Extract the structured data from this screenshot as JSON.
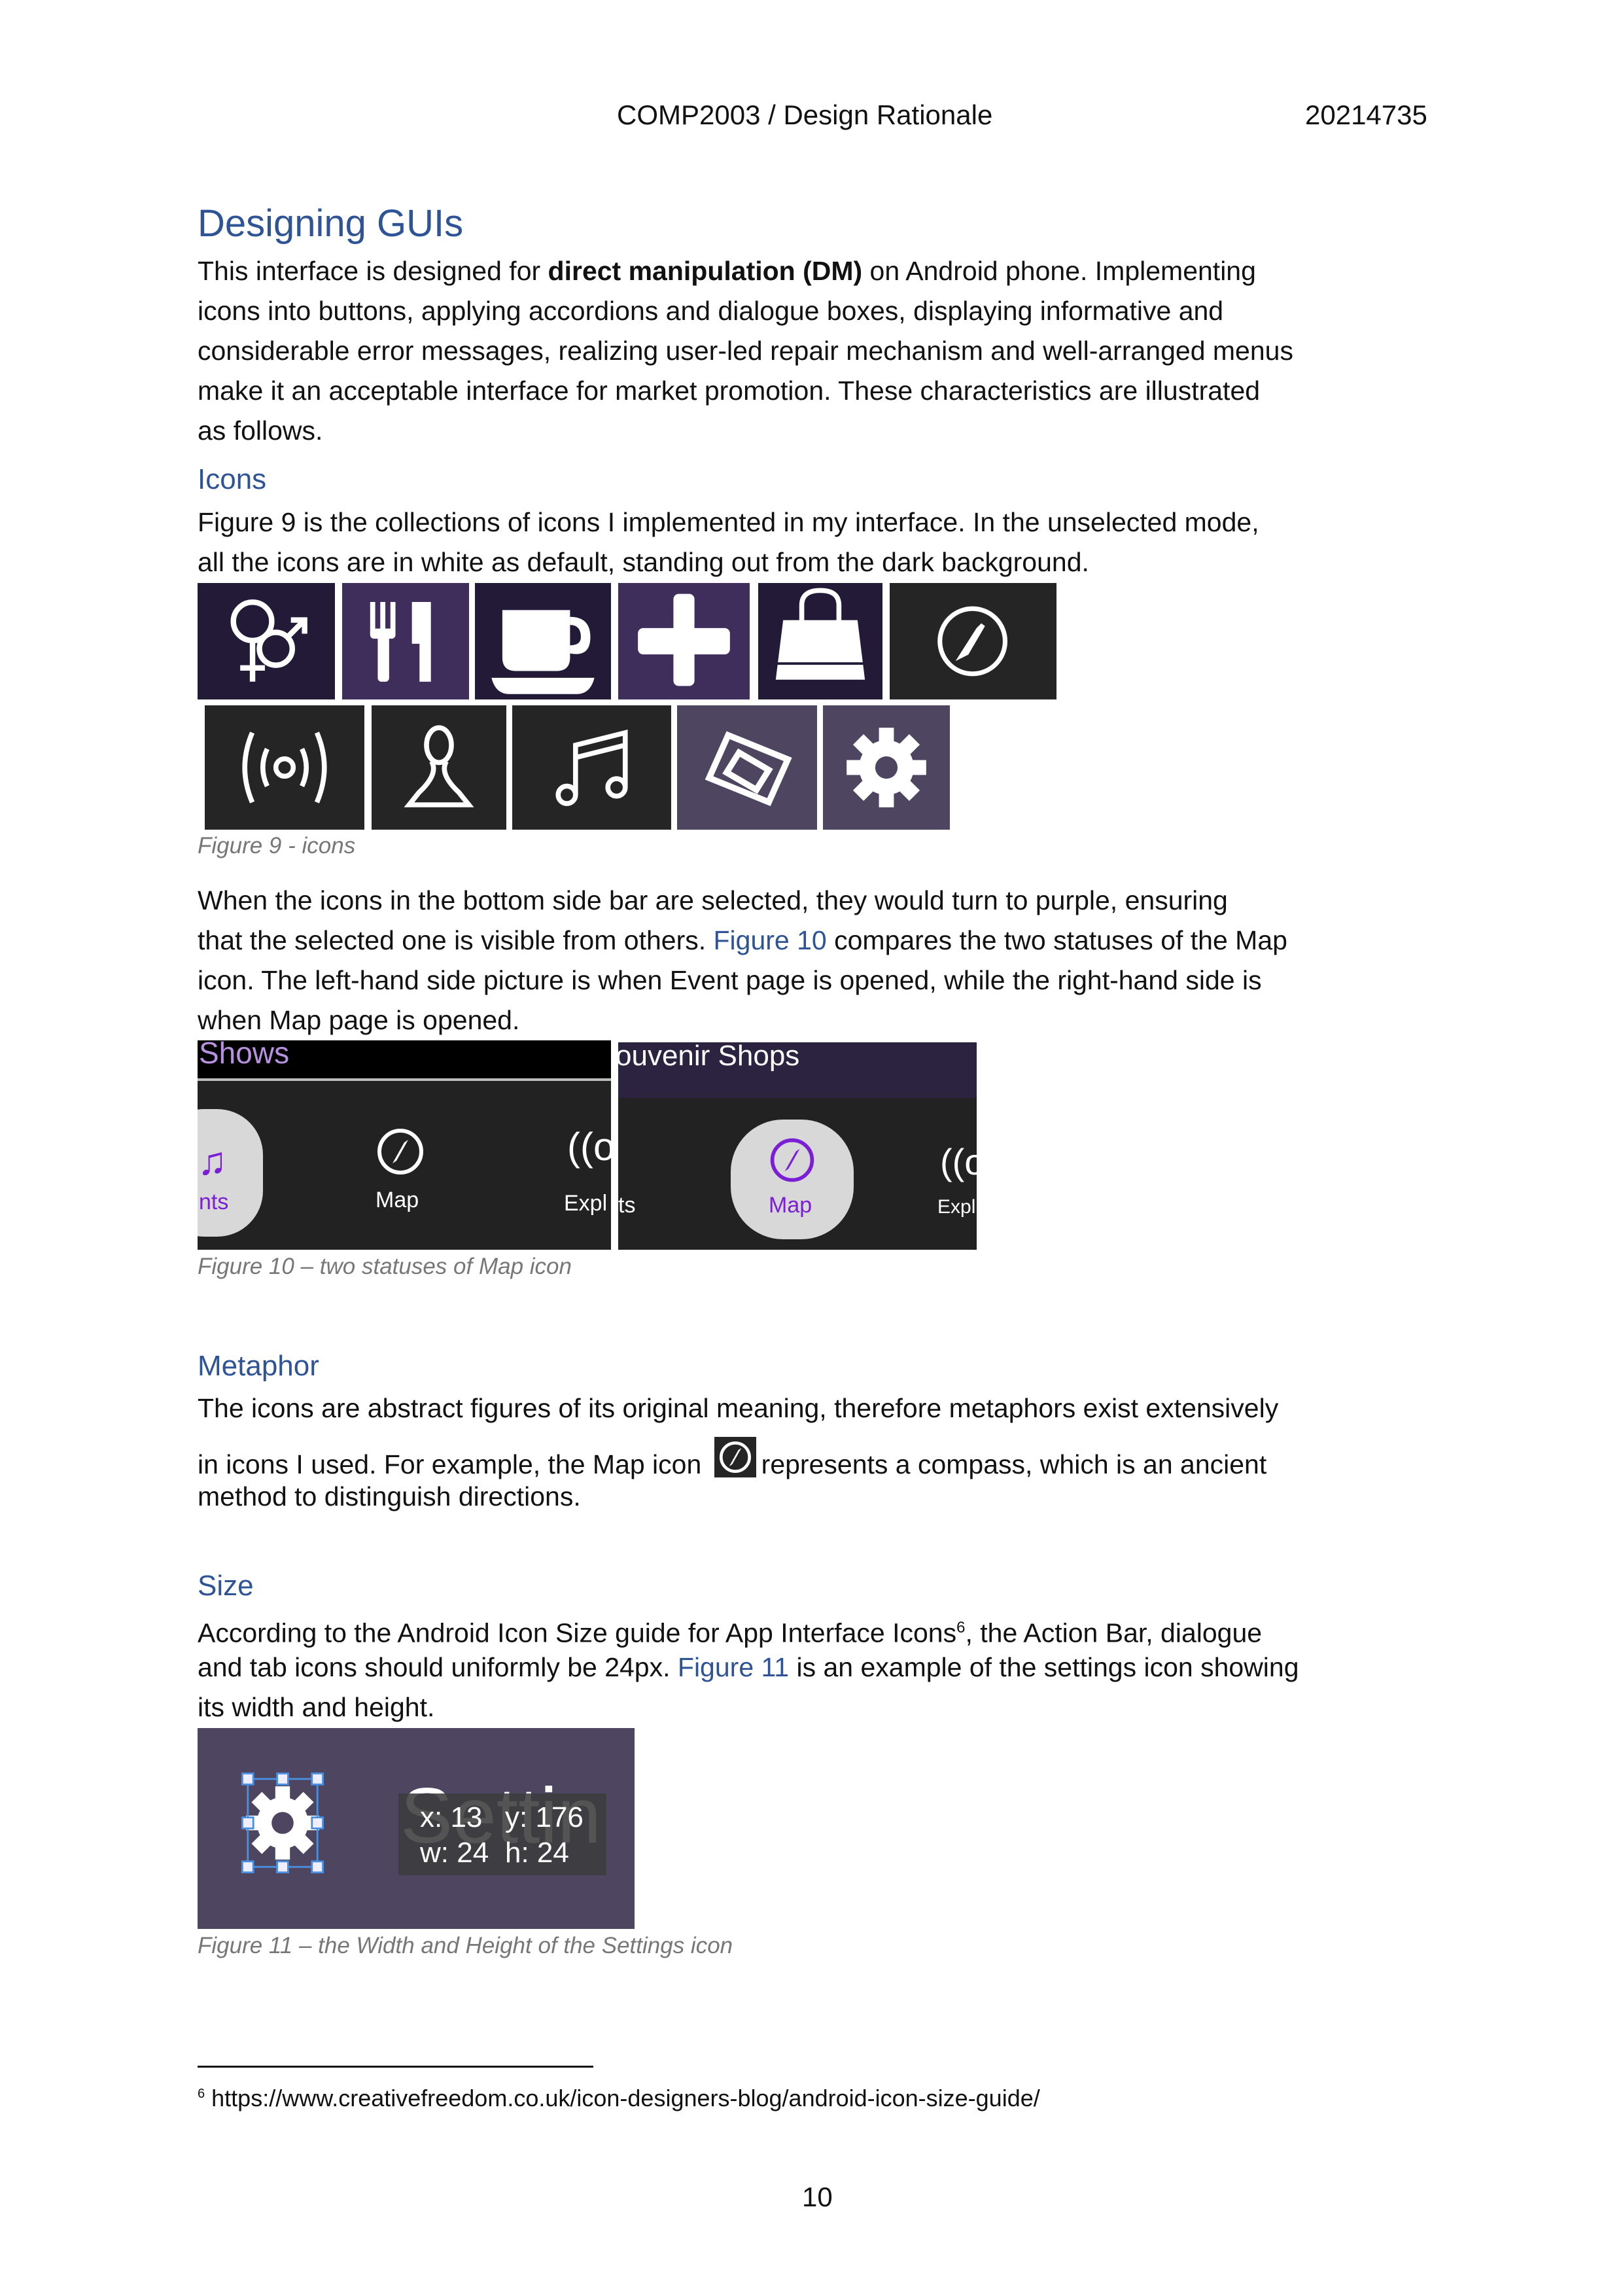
{
  "header": {
    "title": "COMP2003 / Design Rationale",
    "student_id": "20214735"
  },
  "section1": {
    "heading": "Designing GUIs",
    "lines": [
      [
        "This interface is designed for ",
        "direct manipulation (DM)",
        " on Android phone. Implementing"
      ],
      "icons into buttons, applying accordions and dialogue boxes, displaying informative and",
      "considerable error messages, realizing user-led repair mechanism and well-arranged menus",
      "make it an acceptable interface for market promotion. These characteristics are illustrated",
      "as follows."
    ]
  },
  "icons": {
    "heading": "Icons",
    "lines": [
      "Figure 9 is the collections of icons I implemented in my interface. In the unselected mode,",
      "all the icons are in white as default, standing out from the dark background."
    ],
    "figure_caption": "Figure 9 - icons",
    "icon_names": [
      "gender-icon",
      "restaurant-icon",
      "cafe-icon",
      "medical-icon",
      "shopping-bag-icon",
      "compass-icon",
      "broadcast-icon",
      "person-icon",
      "music-icon",
      "ticket-icon",
      "settings-icon"
    ],
    "lines2": [
      "When the icons in the bottom side bar are selected, they would turn to purple, ensuring",
      [
        "that the selected one is visible from others. ",
        "Figure 10",
        " compares the two statuses of the Map"
      ],
      "icon. The left-hand side picture is when Event page is opened, while the right-hand side is",
      "when Map page is opened."
    ],
    "fig10": {
      "left_title": "Shows",
      "right_title": "ouvenir Shops",
      "nav_events": "nts",
      "nav_map": "Map",
      "nav_explore": "Expl",
      "caption": "Figure 10 – two statuses of Map icon"
    },
    "colors": {
      "purple_dark": "#231a38",
      "purple_mid": "#3f2d5c",
      "gray_dark": "#252525",
      "purple_gray": "#4e4560",
      "selected": "#7a1fd6"
    }
  },
  "metaphor": {
    "heading": "Metaphor",
    "lines": [
      "The icons are abstract figures of its original meaning, therefore metaphors exist extensively",
      [
        "in icons I used. For example, the Map icon ",
        "represents a compass, which is an ancient"
      ],
      "method to distinguish directions."
    ]
  },
  "size": {
    "heading": "Size",
    "lines": [
      [
        "According to the Android Icon Size guide for App Interface Icons",
        "6",
        ", the Action Bar, dialogue"
      ],
      [
        "and tab icons should uniformly be 24px. ",
        "Figure 11",
        " is an example of the settings icon showing"
      ],
      "its width and height."
    ],
    "fig11": {
      "bg_text": "Settin",
      "x": "x: 13",
      "y": "y: 176",
      "w": "w: 24",
      "h": "h: 24",
      "caption": "Figure 11 – the Width and Height of the Settings icon"
    }
  },
  "footnote": {
    "number": "6",
    "text": "https://www.creativefreedom.co.uk/icon-designers-blog/android-icon-size-guide/"
  },
  "page_number": "10"
}
